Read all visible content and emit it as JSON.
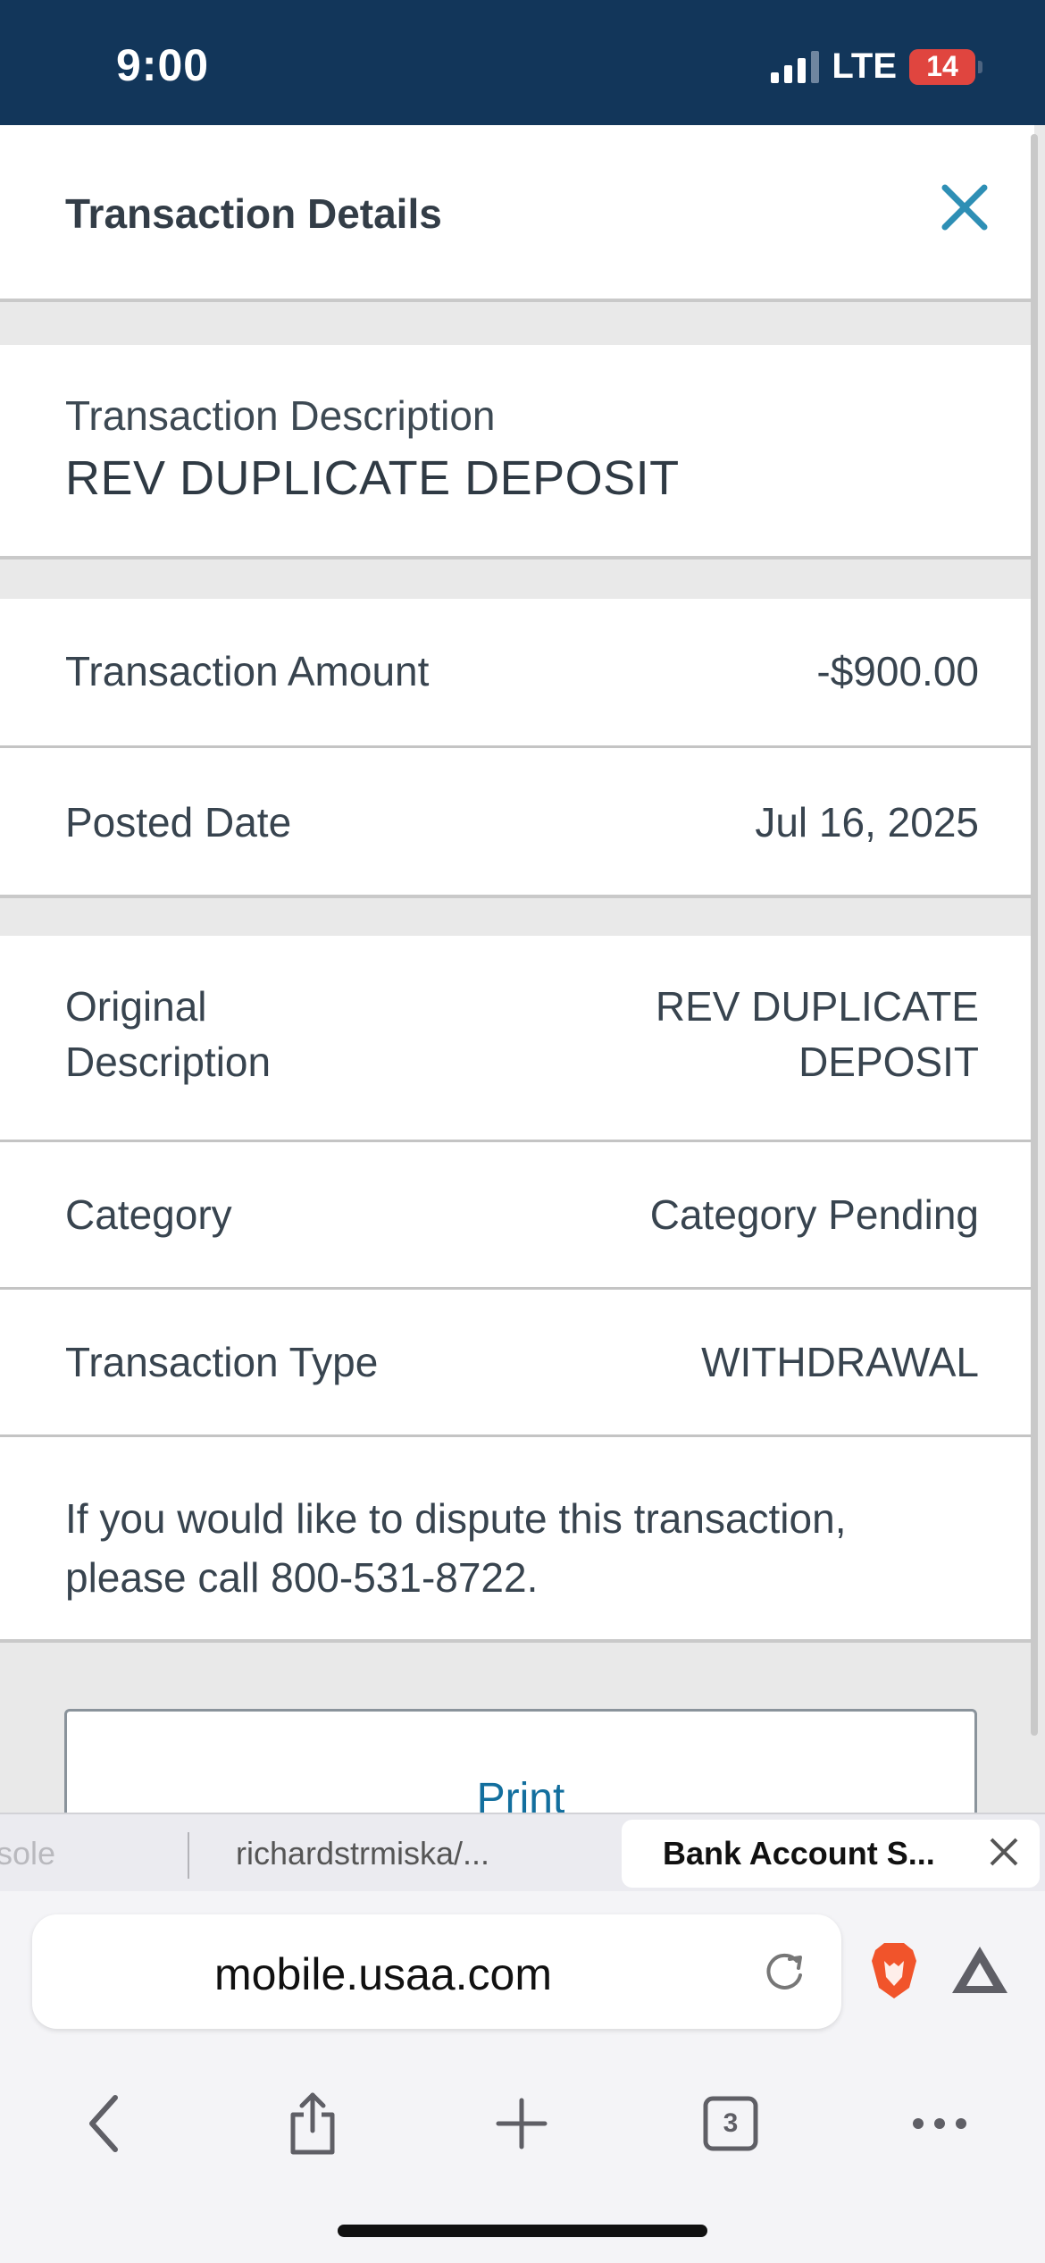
{
  "status_bar": {
    "time": "9:00",
    "network": "LTE",
    "battery_level": "14",
    "signal_icon": "cellular-signal-icon",
    "battery_icon": "battery-icon"
  },
  "header": {
    "title": "Transaction Details",
    "close_icon": "close-icon",
    "accent_color": "#2e8fb5"
  },
  "description": {
    "label": "Transaction Description",
    "value": "REV DUPLICATE DEPOSIT"
  },
  "details": {
    "amount": {
      "label": "Transaction Amount",
      "value": "-$900.00"
    },
    "posted_date": {
      "label": "Posted Date",
      "value": "Jul 16, 2025"
    }
  },
  "extra": {
    "original_description": {
      "label_line1": "Original",
      "label_line2": "Description",
      "value_line1": "REV DUPLICATE",
      "value_line2": "DEPOSIT"
    },
    "category": {
      "label": "Category",
      "value": "Category Pending"
    },
    "transaction_type": {
      "label": "Transaction Type",
      "value": "WITHDRAWAL"
    }
  },
  "dispute_note": {
    "line1": "If you would like to dispute this transaction,",
    "line2": "please call 800-531-8722."
  },
  "print_button": {
    "label": "Print"
  },
  "browser": {
    "tabs": [
      {
        "title": "sole"
      },
      {
        "title": "richardstrmiska/..."
      },
      {
        "title": "Bank Account S..."
      }
    ],
    "url": "mobile.usaa.com",
    "tab_count": "3",
    "icons": [
      "back-icon",
      "share-icon",
      "new-tab-icon",
      "tabs-icon",
      "more-icon",
      "reload-icon",
      "brave-shields-icon",
      "brave-rewards-icon"
    ]
  }
}
